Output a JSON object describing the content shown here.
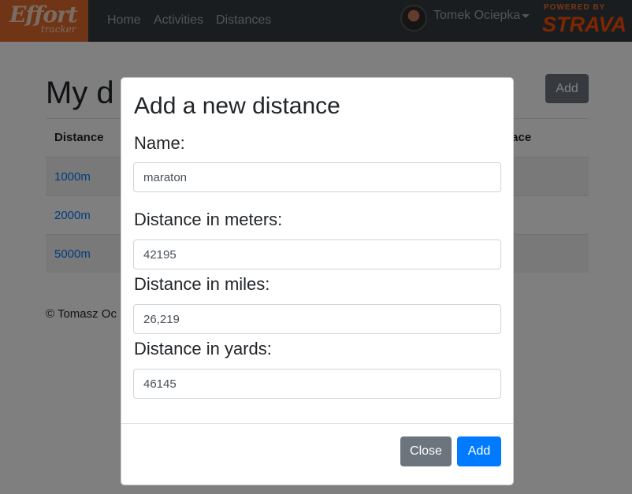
{
  "navbar": {
    "logo_line1": "Effort",
    "logo_line2": "tracker",
    "links": [
      "Home",
      "Activities",
      "Distances"
    ],
    "user_name": "Tomek Ociepka",
    "strava_powered": "POWERED BY",
    "strava_name": "STRAVA"
  },
  "page": {
    "title": "My d",
    "add_label": "Add",
    "table": {
      "headers": [
        "Distance",
        "pace"
      ],
      "rows": [
        "1000m",
        "2000m",
        "5000m"
      ]
    },
    "footer": "© Tomasz Oc"
  },
  "modal": {
    "title": "Add a new distance",
    "name_label": "Name:",
    "name_value": "maraton",
    "meters_label": "Distance in meters:",
    "meters_value": "42195",
    "miles_label": "Distance in miles:",
    "miles_value": "26,219",
    "yards_label": "Distance in yards:",
    "yards_value": "46145",
    "close_label": "Close",
    "add_label": "Add"
  },
  "colors": {
    "navbar": "#343a40",
    "logo": "#e06a2c",
    "primary": "#007bff",
    "secondary": "#6c757d",
    "strava": "#fc4c02"
  }
}
